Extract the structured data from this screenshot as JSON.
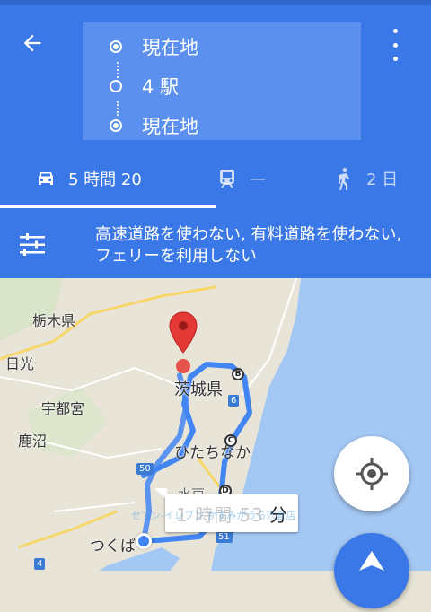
{
  "header": {
    "back_icon": "arrow-back-icon",
    "menu_icon": "more-vert-icon",
    "waypoints": [
      {
        "label": "現在地",
        "type": "filled-circle"
      },
      {
        "label": "4 駅",
        "type": "hollow-circle"
      },
      {
        "label": "現在地",
        "type": "filled-circle"
      }
    ]
  },
  "modes": [
    {
      "icon": "car-icon",
      "label": "5 時間 20",
      "selected": true
    },
    {
      "icon": "train-icon",
      "label": "—",
      "selected": false
    },
    {
      "icon": "walk-icon",
      "label": "2 日",
      "selected": false
    }
  ],
  "options": {
    "icon": "tune-icon",
    "text": "高速道路を使わない, 有料道路を使わない, フェリーを利用しない"
  },
  "map": {
    "labels": [
      {
        "text": "栃木県"
      },
      {
        "text": "日光"
      },
      {
        "text": "宇都宮"
      },
      {
        "text": "鹿沼"
      },
      {
        "text": "茨城県"
      },
      {
        "text": "ひたちなか"
      },
      {
        "text": "つくば"
      },
      {
        "text": "水戸"
      }
    ],
    "waypoint_letters": [
      "B",
      "C",
      "D"
    ],
    "route_numbers": [
      "6",
      "50",
      "51",
      "4"
    ],
    "duration": {
      "blurred": "1 時間 53",
      "unit": "分"
    },
    "watermark": "セブン-イレブン かすみがうら宍倉店",
    "colors": {
      "route": "#4285f4",
      "water": "#a4c8f4",
      "land": "#e8e4d8",
      "accent": "#3b78e7"
    }
  },
  "buttons": {
    "my_location_icon": "my-location-icon",
    "navigate_icon": "navigation-icon"
  }
}
